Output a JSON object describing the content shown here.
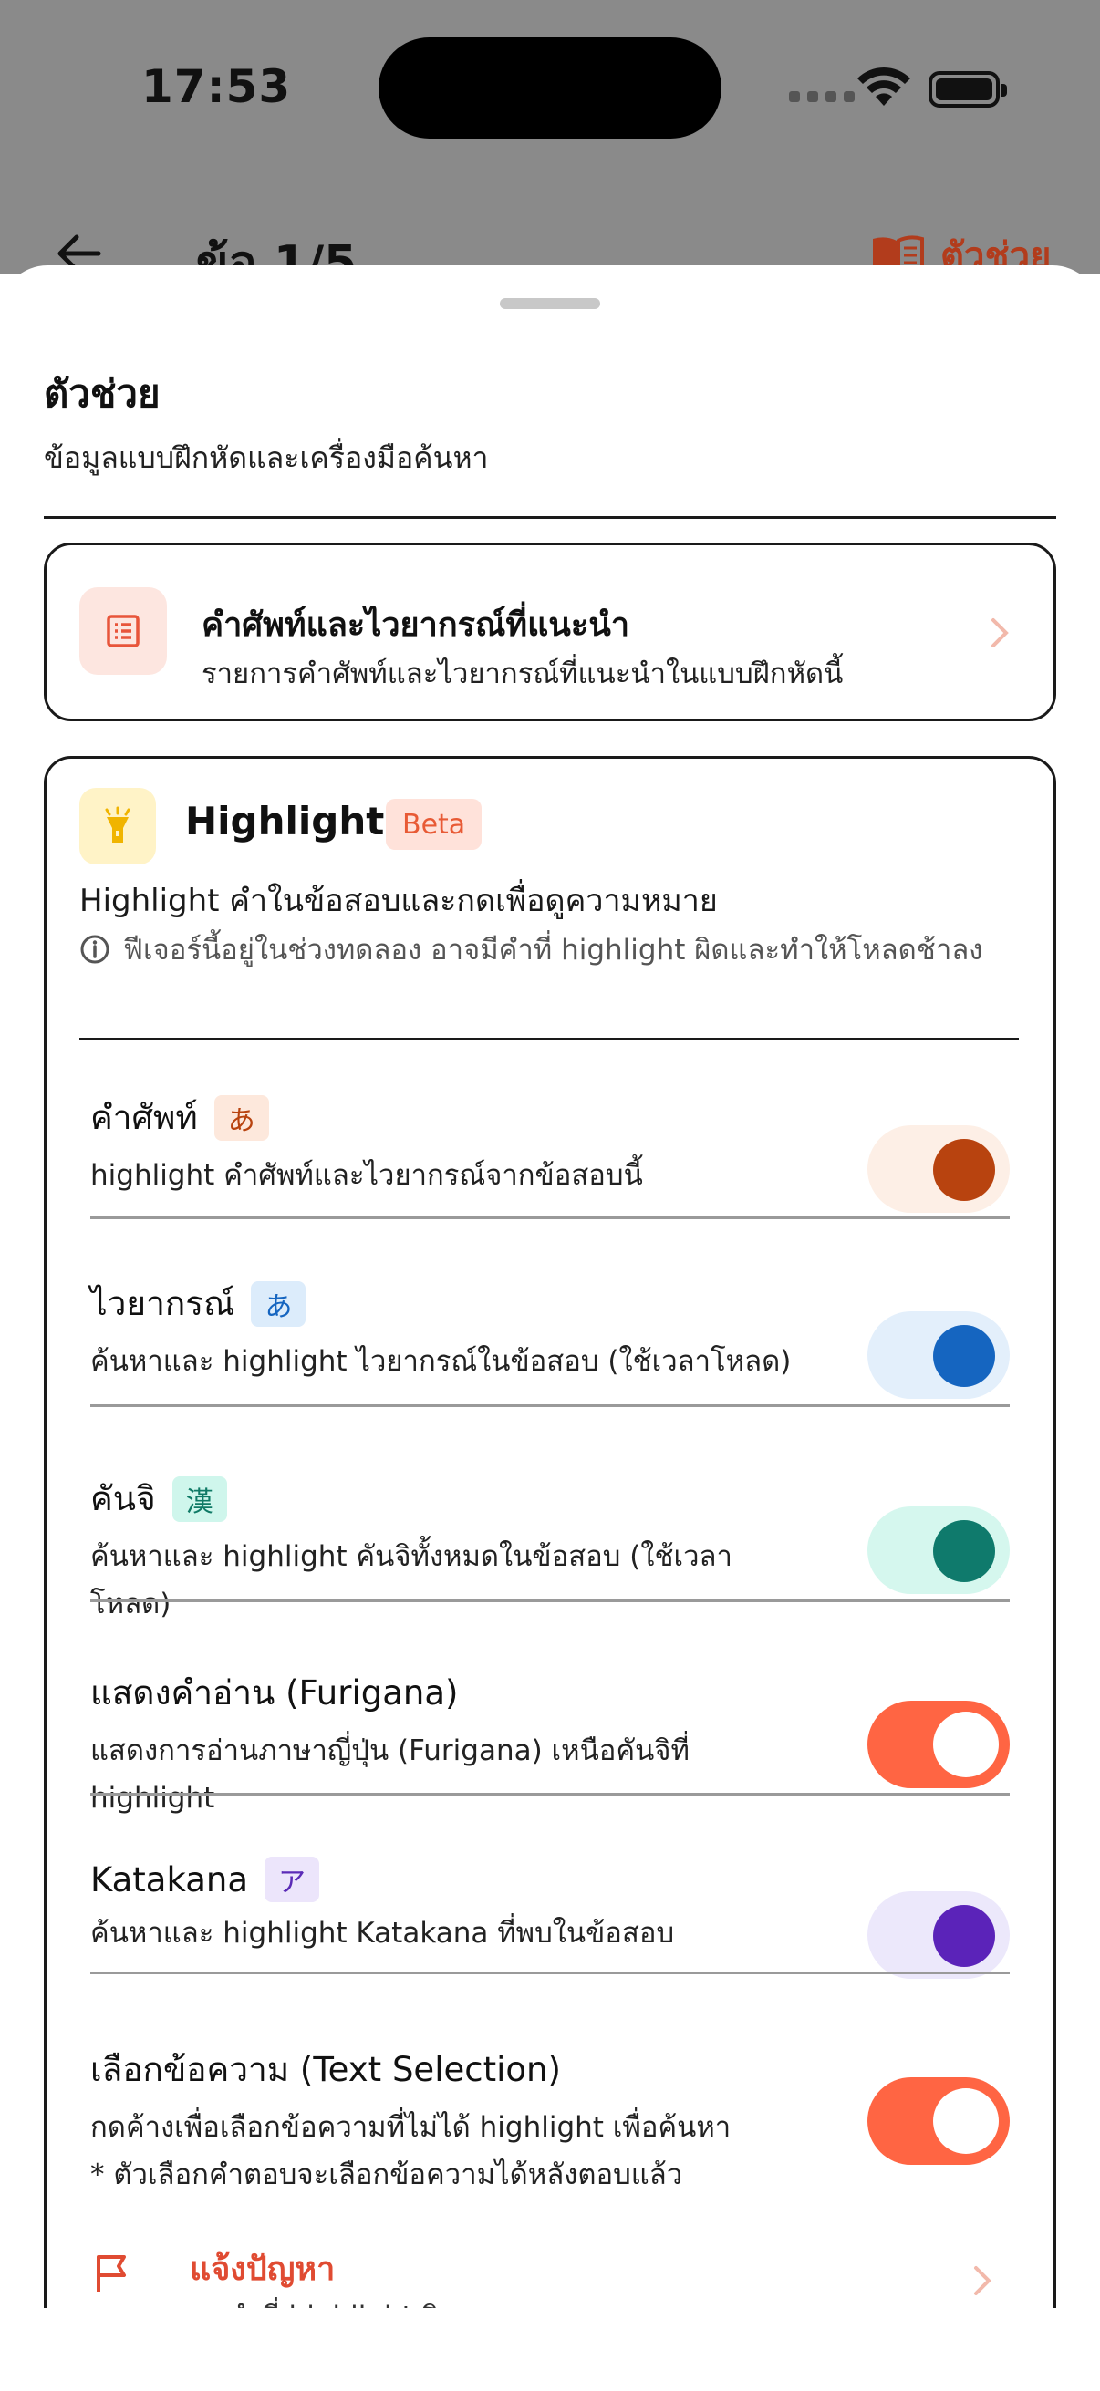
{
  "status_bar": {
    "time": "17:53"
  },
  "nav": {
    "title": "ข้อ 1/5",
    "help_label": "ตัวช่วย"
  },
  "sheet": {
    "title": "ตัวช่วย",
    "subtitle": "ข้อมูลแบบฝึกหัดและเครื่องมือค้นหา"
  },
  "vocab_card": {
    "title": "คำศัพท์และไวยากรณ์ที่แนะนำ",
    "description": "รายการคำศัพท์และไวยากรณ์ที่แนะนำในแบบฝึกหัดนี้",
    "icon": "list-icon"
  },
  "highlight_card": {
    "title": "Highlight",
    "badge": "Beta",
    "description": "Highlight คำในข้อสอบและกดเพื่อดูความหมาย",
    "note": "ฟีเจอร์นี้อยู่ในช่วงทดลอง อาจมีคำที่ highlight ผิดและทำให้โหลดช้าลง",
    "icon": "flashlight-icon",
    "settings": [
      {
        "title": "คำศัพท์",
        "badge": "あ",
        "description": "highlight คำศัพท์และไวยากรณ์จากข้อสอบนี้",
        "enabled": true,
        "badge_bg": "#fde8dc",
        "badge_fg": "#b8430f",
        "toggle_bg": "#fdefe6",
        "knob": "#b8430f"
      },
      {
        "title": "ไวยากรณ์",
        "badge": "あ",
        "description": "ค้นหาและ highlight ไวยากรณ์ในข้อสอบ (ใช้เวลาโหลด)",
        "enabled": true,
        "badge_bg": "#dcecfb",
        "badge_fg": "#1565c0",
        "toggle_bg": "#e3effb",
        "knob": "#1565c0"
      },
      {
        "title": "คันจิ",
        "badge": "漢",
        "description": "ค้นหาและ highlight คันจิทั้งหมดในข้อสอบ (ใช้เวลาโหลด)",
        "enabled": true,
        "badge_bg": "#cff6ec",
        "badge_fg": "#0f7a66",
        "toggle_bg": "#d5f7ee",
        "knob": "#0f7a6c"
      },
      {
        "title": "แสดงคำอ่าน (Furigana)",
        "badge": "",
        "description": "แสดงการอ่านภาษาญี่ปุ่น (Furigana) เหนือคันจิที่ highlight",
        "enabled": true,
        "badge_bg": "",
        "badge_fg": "",
        "toggle_bg": "#ff6543",
        "knob": "#ffffff"
      },
      {
        "title": "Katakana",
        "badge": "ア",
        "description": "ค้นหาและ highlight Katakana ที่พบในข้อสอบ",
        "enabled": true,
        "badge_bg": "#ece5fb",
        "badge_fg": "#5b2bb7",
        "toggle_bg": "#ece8fb",
        "knob": "#5b23b9"
      },
      {
        "title": "เลือกข้อความ (Text Selection)",
        "badge": "",
        "description": "กดค้างเพื่อเลือกข้อความที่ไม่ได้ highlight เพื่อค้นหา\n* ตัวเลือกคำตอบจะเลือกข้อความได้หลังตอบแล้ว",
        "enabled": true,
        "badge_bg": "",
        "badge_fg": "",
        "toggle_bg": "#ff6543",
        "knob": "#ffffff"
      }
    ]
  },
  "report": {
    "title": "แจ้งปัญหา",
    "description": "พบคำที่ highlight ผิดพลาด"
  }
}
